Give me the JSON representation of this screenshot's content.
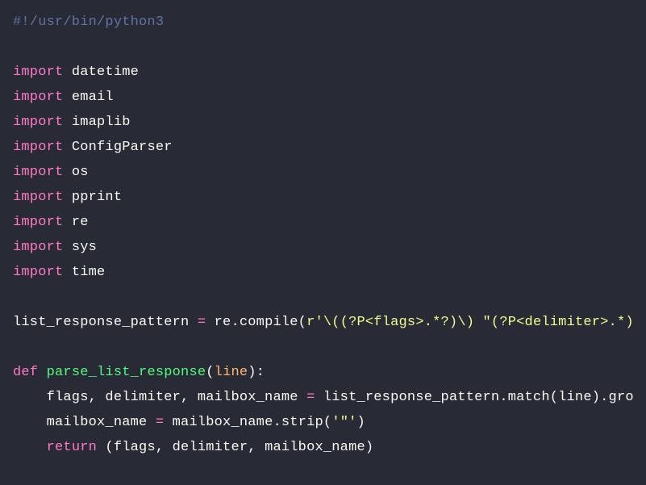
{
  "code": {
    "l01_shebang": "#!/usr/bin/python3",
    "l03_import": "import",
    "l03_mod": " datetime",
    "l04_import": "import",
    "l04_mod": " email",
    "l05_import": "import",
    "l05_mod": " imaplib",
    "l06_import": "import",
    "l06_mod": " ConfigParser",
    "l07_import": "import",
    "l07_mod": " os",
    "l08_import": "import",
    "l08_mod": " pprint",
    "l09_import": "import",
    "l09_mod": " re",
    "l10_import": "import",
    "l10_mod": " sys",
    "l11_import": "import",
    "l11_mod": " time",
    "l13_lhs": "list_response_pattern ",
    "l13_eq": "=",
    "l13_mid": " re",
    "l13_dot1": ".",
    "l13_compile": "compile(",
    "l13_str": "r'\\((?P<flags>.*?)\\) \"(?P<delimiter>.*)",
    "l15_def": "def",
    "l15_sp": " ",
    "l15_fn": "parse_list_response",
    "l15_open": "(",
    "l15_param": "line",
    "l15_close": "):",
    "l16_indent": "    flags, delimiter, mailbox_name ",
    "l16_eq": "=",
    "l16_mid": " list_response_pattern",
    "l16_dot1": ".",
    "l16_match": "match(line)",
    "l16_dot2": ".",
    "l16_gro": "gro",
    "l17_lhs": "    mailbox_name ",
    "l17_eq": "=",
    "l17_mid": " mailbox_name",
    "l17_dot": ".",
    "l17_strip": "strip(",
    "l17_str": "'\"'",
    "l17_close": ")",
    "l18_indent": "    ",
    "l18_return": "return",
    "l18_rest": " (flags, delimiter, mailbox_name)"
  }
}
